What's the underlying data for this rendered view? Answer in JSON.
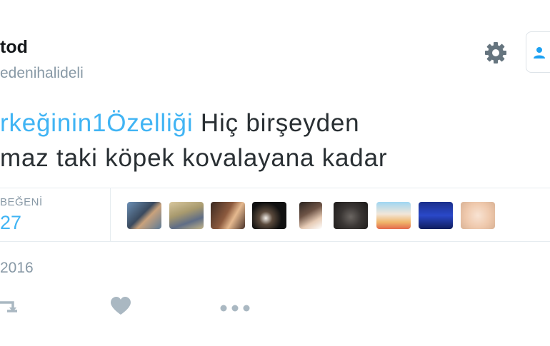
{
  "profile": {
    "name": "tod",
    "handle": "edenihalideli"
  },
  "tweet": {
    "hashtag": "rkeğinin1Özelliği",
    "text_line1_rest": " Hiç birşeyden",
    "text_line2": "maz taki köpek kovalayana kadar"
  },
  "stats": {
    "likes_label": "BEĞENİ",
    "likes_count": "27"
  },
  "likers": [
    {
      "name": "liker-1"
    },
    {
      "name": "liker-2"
    },
    {
      "name": "liker-3"
    },
    {
      "name": "liker-4"
    },
    {
      "name": "liker-5"
    },
    {
      "name": "liker-6"
    },
    {
      "name": "liker-7"
    },
    {
      "name": "liker-8"
    },
    {
      "name": "liker-9"
    }
  ],
  "timestamp": "2016",
  "icons": {
    "settings": "gear-icon",
    "follow": "follow-user-icon",
    "retweet": "retweet-icon",
    "like": "heart-icon",
    "more": "more-dots-icon"
  },
  "colors": {
    "accent": "#40b4f4",
    "muted": "#8899a6",
    "text": "#292f33"
  }
}
